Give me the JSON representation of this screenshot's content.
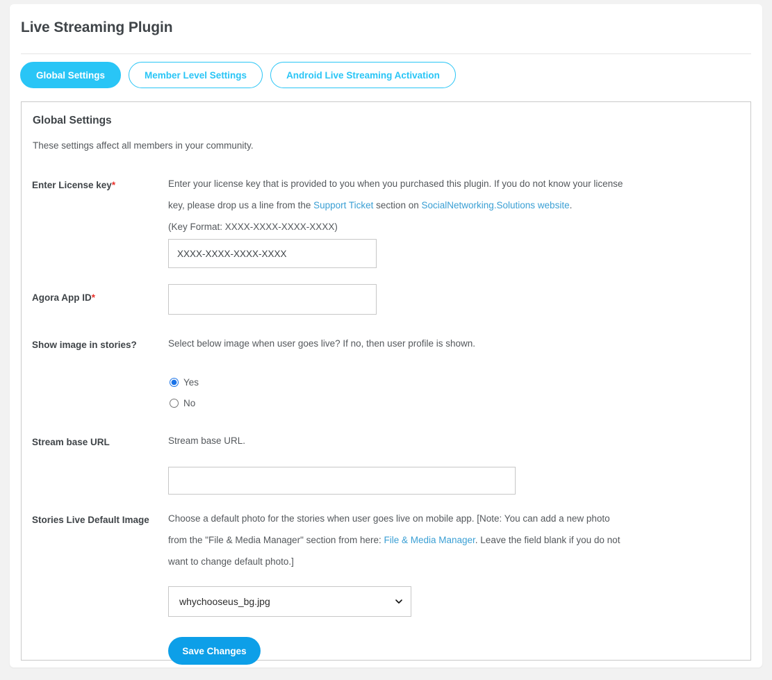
{
  "header": {
    "title": "Live Streaming Plugin"
  },
  "tabs": [
    {
      "label": "Global Settings",
      "active": true
    },
    {
      "label": "Member Level Settings",
      "active": false
    },
    {
      "label": "Android Live Streaming Activation",
      "active": false
    }
  ],
  "panel": {
    "title": "Global Settings",
    "subtitle": "These settings affect all members in your community."
  },
  "fields": {
    "license_key": {
      "label": "Enter License key",
      "required_marker": "*",
      "desc_part1": "Enter your license key that is provided to you when you purchased this plugin. If you do not know your license key, please drop us a line from the ",
      "link1": "Support Ticket",
      "desc_part2": " section on ",
      "link2": "SocialNetworking.Solutions website",
      "desc_part3": ".",
      "desc_line3": "(Key Format: XXXX-XXXX-XXXX-XXXX)",
      "placeholder": "XXXX-XXXX-XXXX-XXXX",
      "value": ""
    },
    "agora_app_id": {
      "label": "Agora App ID",
      "required_marker": "*",
      "placeholder": "",
      "value": ""
    },
    "show_image_in_stories": {
      "label": "Show image in stories?",
      "desc": "Select below image when user goes live? If no, then user profile is shown.",
      "options": [
        {
          "label": "Yes",
          "value": "yes",
          "selected": true
        },
        {
          "label": "No",
          "value": "no",
          "selected": false
        }
      ]
    },
    "stream_base_url": {
      "label": "Stream base URL",
      "desc": "Stream base URL.",
      "placeholder": "",
      "value": ""
    },
    "stories_live_default_image": {
      "label": "Stories Live Default Image",
      "desc_part1": "Choose a default photo for the stories when user goes live on mobile app. [Note: You can add a new photo from the \"File & Media Manager\" section from here: ",
      "link1": "File & Media Manager",
      "desc_part2": ". Leave the field blank if you do not want to change default photo.]",
      "selected_option": "whychooseus_bg.jpg",
      "options": [
        "whychooseus_bg.jpg"
      ]
    }
  },
  "actions": {
    "save_label": "Save Changes"
  },
  "colors": {
    "accent_cyan": "#29c5f6",
    "button_blue": "#0d9fe8",
    "link_blue": "#3a9fd4",
    "required_red": "#e8302a",
    "page_background": "#f2f2f2"
  }
}
